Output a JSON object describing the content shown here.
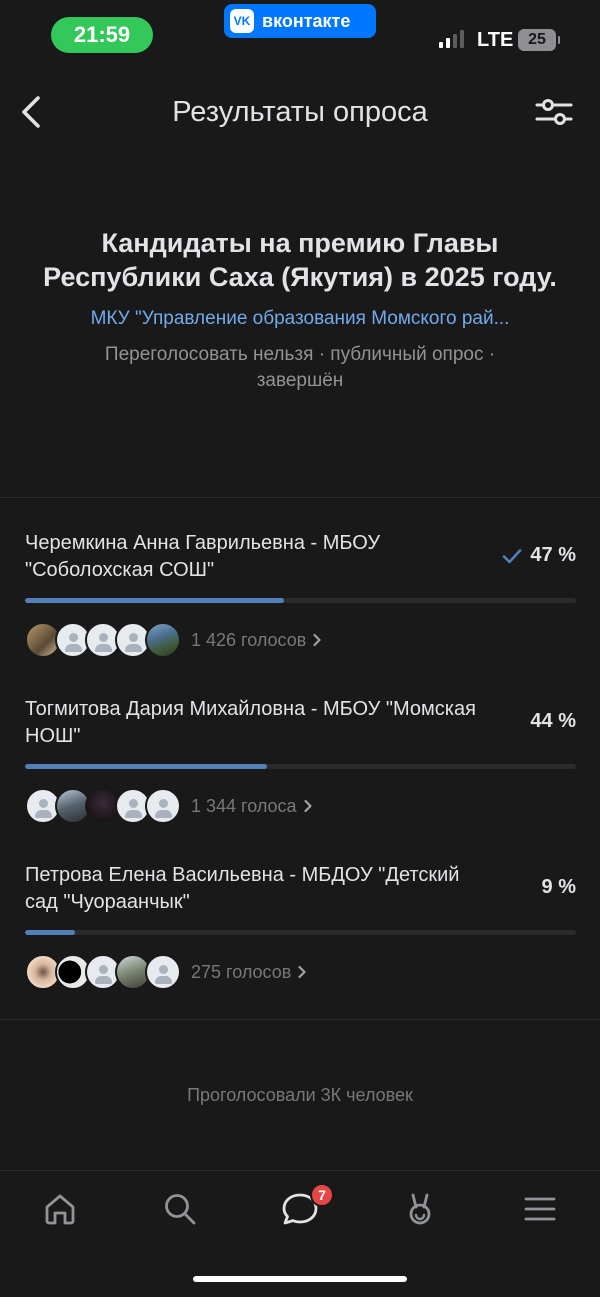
{
  "status_bar": {
    "time": "21:59",
    "app_name": "вконтакте",
    "app_logo": "VK",
    "network": "LTE",
    "battery": "25"
  },
  "header": {
    "title": "Результаты опроса",
    "back_icon": "chevron-left-icon",
    "filter_icon": "sliders-icon"
  },
  "poll": {
    "title": "Кандидаты на премию Главы Республики Саха (Якутия) в 2025 году.",
    "author": "МКУ \"Управление образования Момского рай...",
    "meta": "Переголосовать нельзя · публичный опрос · завершён",
    "options": [
      {
        "text": "Черемкина Анна Гаврильевна - МБОУ \"Соболохская СОШ\"",
        "percent_label": "47 %",
        "percent": 47,
        "voted": true,
        "votes_label": "1 426 голосов"
      },
      {
        "text": "Тогмитова Дария Михайловна - МБОУ \"Момская НОШ\"",
        "percent_label": "44 %",
        "percent": 44,
        "voted": false,
        "votes_label": "1 344 голоса"
      },
      {
        "text": "Петрова Елена Васильевна - МБДОУ \"Детский сад \"Чуораанчык\"",
        "percent_label": "9 %",
        "percent": 9,
        "voted": false,
        "votes_label": "275 голосов"
      }
    ],
    "total_label": "Проголосовали 3К человек"
  },
  "tabbar": {
    "items": [
      {
        "name": "home-icon"
      },
      {
        "name": "search-icon"
      },
      {
        "name": "messages-icon",
        "badge": "7"
      },
      {
        "name": "clips-icon"
      },
      {
        "name": "menu-icon"
      }
    ]
  },
  "colors": {
    "background": "#19191a",
    "accent": "#71aaeb",
    "bar": "#5181b8",
    "badge": "#e64646",
    "time_pill": "#34c759"
  }
}
